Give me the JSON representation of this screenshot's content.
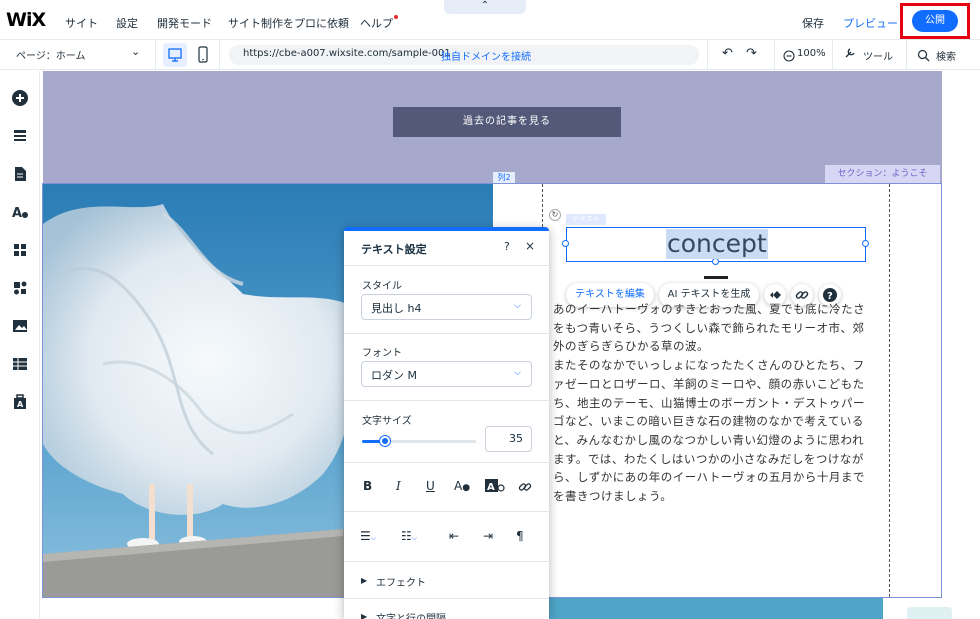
{
  "topbar": {
    "logo": "WiX",
    "menu": [
      "サイト",
      "設定",
      "開発モード",
      "サイト制作をプロに依頼",
      "ヘルプ"
    ],
    "collapse": "⌃",
    "save": "保存",
    "preview": "プレビュー",
    "publish": "公開"
  },
  "secondbar": {
    "page": "ページ：ホーム",
    "url": "https://cbe-a007.wixsite.com/sample-001",
    "connect_domain": "独自ドメインを接続",
    "zoom": "100%",
    "tools": "ツール",
    "search": "検索"
  },
  "canvas": {
    "past_articles_button": "過去の記事を見る",
    "section_label": "セクション：ようこそ",
    "column_label": "列2",
    "text_tag": "テキスト",
    "heading": "concept",
    "edit_text_button": "テキストを編集",
    "ai_text_button": "AI テキストを生成",
    "body_lines": [
      "あのイーハトーヴォのすきとおった風、夏でも底に冷たさ",
      "をもつ青いそら、うつくしい森で飾られたモリーオ市、郊",
      "外のぎらぎらひかる草の波。",
      "またそのなかでいっしょになったたくさんのひとたち、フ",
      "ァゼーロとロザーロ、羊飼のミーロや、顔の赤いこどもた",
      "ち、地主のテーモ、山猫博士のボーガント・デストゥパー",
      "ゴなど、いまこの暗い巨きな石の建物のなかで考えている",
      "と、みんなむかし風のなつかしい青い幻燈のように思われ",
      "ます。では、わたくしはいつかの小さなみだしをつけなが",
      "ら、しずかにあの年のイーハトーヴォの五月から十月まで",
      "を書きつけましょう。"
    ]
  },
  "panel": {
    "title": "テキスト設定",
    "help": "?",
    "close": "×",
    "style_label": "スタイル",
    "style_value": "見出し h4",
    "font_label": "フォント",
    "font_value": "ロダン M",
    "size_label": "文字サイズ",
    "size_value": "35",
    "size_slider_fraction": 0.2,
    "effect_label": "エフェクト",
    "spacing_label": "文字と行の間隔"
  },
  "colors": {
    "accent": "#116dff",
    "publish_highlight": "#e60012",
    "header_bg": "#a6a8cc",
    "button_bg": "#54597a",
    "section_label_bg": "#d7d6f5"
  },
  "icons": {
    "sidebar": [
      "add-icon",
      "menus-icon",
      "pages-icon",
      "design-icon",
      "app-market-icon",
      "business-icon",
      "media-icon",
      "cms-icon",
      "portfolio-icon"
    ]
  }
}
